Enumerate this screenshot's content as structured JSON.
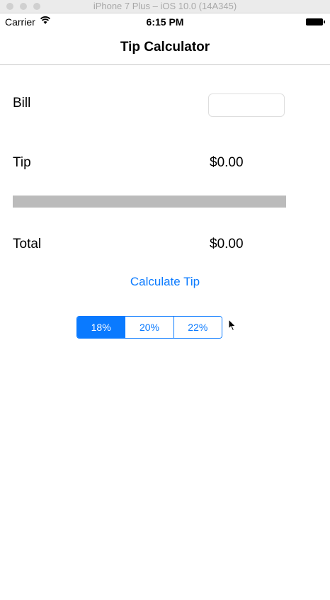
{
  "simulator": {
    "title": "iPhone 7 Plus – iOS 10.0 (14A345)"
  },
  "status_bar": {
    "carrier": "Carrier",
    "time": "6:15 PM"
  },
  "nav": {
    "title": "Tip Calculator"
  },
  "bill": {
    "label": "Bill",
    "value": ""
  },
  "tip": {
    "label": "Tip",
    "value": "$0.00"
  },
  "total": {
    "label": "Total",
    "value": "$0.00"
  },
  "calculate_button": {
    "label": "Calculate Tip"
  },
  "tip_percent": {
    "options": [
      "18%",
      "20%",
      "22%"
    ],
    "selected": "18%"
  },
  "colors": {
    "accent": "#0a7aff",
    "divider": "#bbbbbb"
  }
}
